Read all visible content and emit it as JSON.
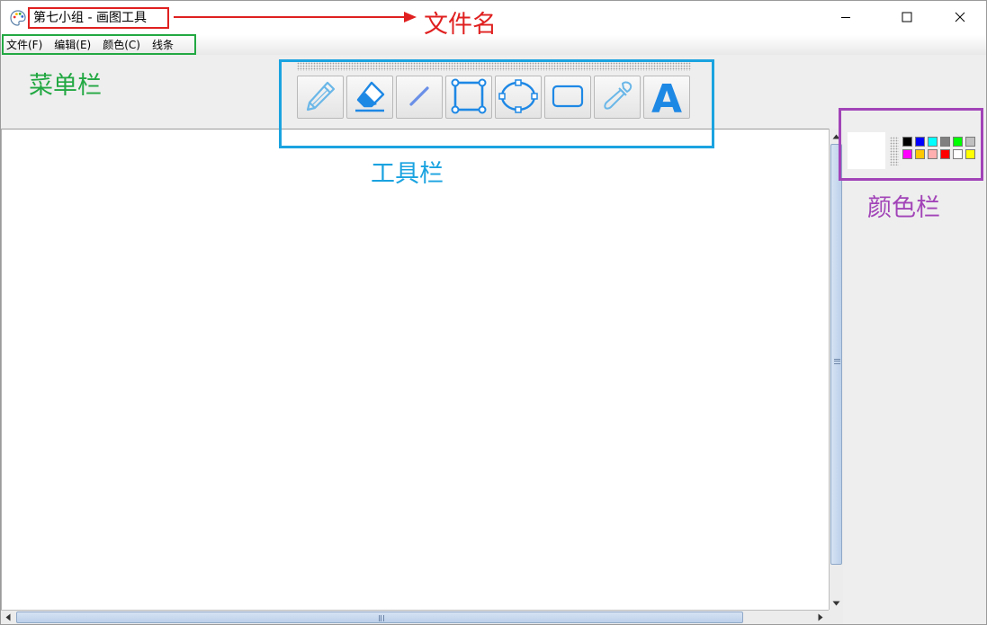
{
  "window": {
    "title": "第七小组 - 画图工具",
    "controls": {
      "minimize": "minimize-icon",
      "maximize": "maximize-icon",
      "close": "close-icon"
    }
  },
  "menubar": {
    "items": [
      {
        "label": "文件(F)"
      },
      {
        "label": "编辑(E)"
      },
      {
        "label": "颜色(C)"
      },
      {
        "label": "线条"
      }
    ]
  },
  "toolbar": {
    "tools": [
      {
        "name": "pencil",
        "icon": "pencil-icon"
      },
      {
        "name": "eraser",
        "icon": "eraser-icon"
      },
      {
        "name": "line",
        "icon": "line-icon"
      },
      {
        "name": "rectangle",
        "icon": "rectangle-select-icon"
      },
      {
        "name": "ellipse",
        "icon": "ellipse-icon"
      },
      {
        "name": "rounded-rectangle",
        "icon": "rounded-rectangle-icon"
      },
      {
        "name": "color-picker",
        "icon": "eyedropper-icon"
      },
      {
        "name": "text",
        "icon": "text-icon",
        "glyph": "A"
      }
    ]
  },
  "palette": {
    "current_color": "#ffffff",
    "swatches": [
      "#000000",
      "#0000ff",
      "#00ffff",
      "#808080",
      "#00ff00",
      "#c0c0c0",
      "#ff00ff",
      "#ffc800",
      "#ffafaf",
      "#ff0000",
      "#ffffff",
      "#ffff00"
    ]
  },
  "annotations": {
    "filename": "文件名",
    "menubar": "菜单栏",
    "toolbar": "工具栏",
    "colorbar": "颜色栏"
  },
  "colors": {
    "accent_blue": "#1e88e5",
    "annotation_red": "#e02020",
    "annotation_green": "#22a842",
    "annotation_blue": "#1aa3e0",
    "annotation_purple": "#a244b8"
  }
}
